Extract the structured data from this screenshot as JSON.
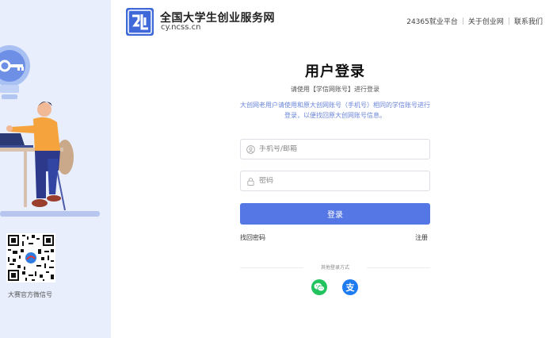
{
  "header": {
    "brand_name": "全国大学生创业服务网",
    "brand_domain": "cy.ncss.cn",
    "links": [
      {
        "label": "24365就业平台"
      },
      {
        "label": "关于创业网"
      },
      {
        "label": "联系我们"
      }
    ]
  },
  "sidebar": {
    "qr_caption": "大赛官方微信号"
  },
  "login": {
    "title": "用户登录",
    "subtitle": "请使用【学信网账号】进行登录",
    "notice": "大创网老用户请使用和原大创网账号（手机号）相同的学信账号进行登录，以便找回原大创网账号信息。",
    "phone_placeholder": "手机号/邮箱",
    "password_placeholder": "密码",
    "submit_label": "登录",
    "forgot_label": "找回密码",
    "register_label": "注册",
    "other_methods_label": "其他登录方式",
    "alipay_glyph": "支"
  },
  "colors": {
    "primary": "#5577e6",
    "side_bg": "#e8eefc",
    "wechat": "#22c35e",
    "alipay": "#1e7cf0"
  }
}
